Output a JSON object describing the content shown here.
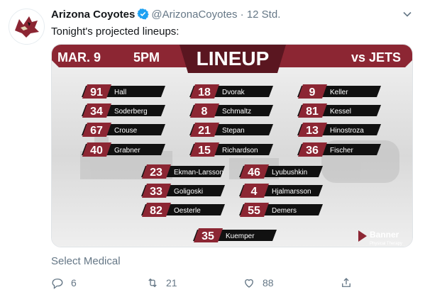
{
  "tweet": {
    "author_name": "Arizona Coyotes",
    "author_handle": "@ArizonaCoyotes",
    "separator": "·",
    "time": "12 Std.",
    "text": "Tonight's projected lineups:",
    "sponsor_text": "Select Medical"
  },
  "card": {
    "date": "MAR. 9",
    "time": "5PM",
    "title": "LINEUP",
    "opponent": "vs JETS",
    "sponsor_brand": "Banner",
    "sponsor_sub": "Physical Therapy",
    "forwards_left": [
      {
        "number": "91",
        "name": "Hall"
      },
      {
        "number": "34",
        "name": "Soderberg"
      },
      {
        "number": "67",
        "name": "Crouse"
      },
      {
        "number": "40",
        "name": "Grabner"
      }
    ],
    "forwards_center": [
      {
        "number": "18",
        "name": "Dvorak"
      },
      {
        "number": "8",
        "name": "Schmaltz"
      },
      {
        "number": "21",
        "name": "Stepan"
      },
      {
        "number": "15",
        "name": "Richardson"
      }
    ],
    "forwards_right": [
      {
        "number": "9",
        "name": "Keller"
      },
      {
        "number": "81",
        "name": "Kessel"
      },
      {
        "number": "13",
        "name": "Hinostroza"
      },
      {
        "number": "36",
        "name": "Fischer"
      }
    ],
    "defense_left": [
      {
        "number": "23",
        "name": "Ekman-Larsson"
      },
      {
        "number": "33",
        "name": "Goligoski"
      },
      {
        "number": "82",
        "name": "Oesterle"
      }
    ],
    "defense_right": [
      {
        "number": "46",
        "name": "Lyubushkin"
      },
      {
        "number": "4",
        "name": "Hjalmarsson"
      },
      {
        "number": "55",
        "name": "Demers"
      }
    ],
    "goalie": {
      "number": "35",
      "name": "Kuemper"
    }
  },
  "actions": {
    "reply_count": "6",
    "retweet_count": "21",
    "like_count": "88"
  },
  "icons": {
    "verified": "verified-badge-icon",
    "caret": "chevron-down-icon",
    "reply": "reply-icon",
    "retweet": "retweet-icon",
    "like": "heart-icon",
    "share": "share-icon"
  },
  "colors": {
    "coyotes_red": "#8c2633",
    "dark_red": "#5a1620",
    "verified_blue": "#1da1f2",
    "muted_text": "#657786"
  }
}
